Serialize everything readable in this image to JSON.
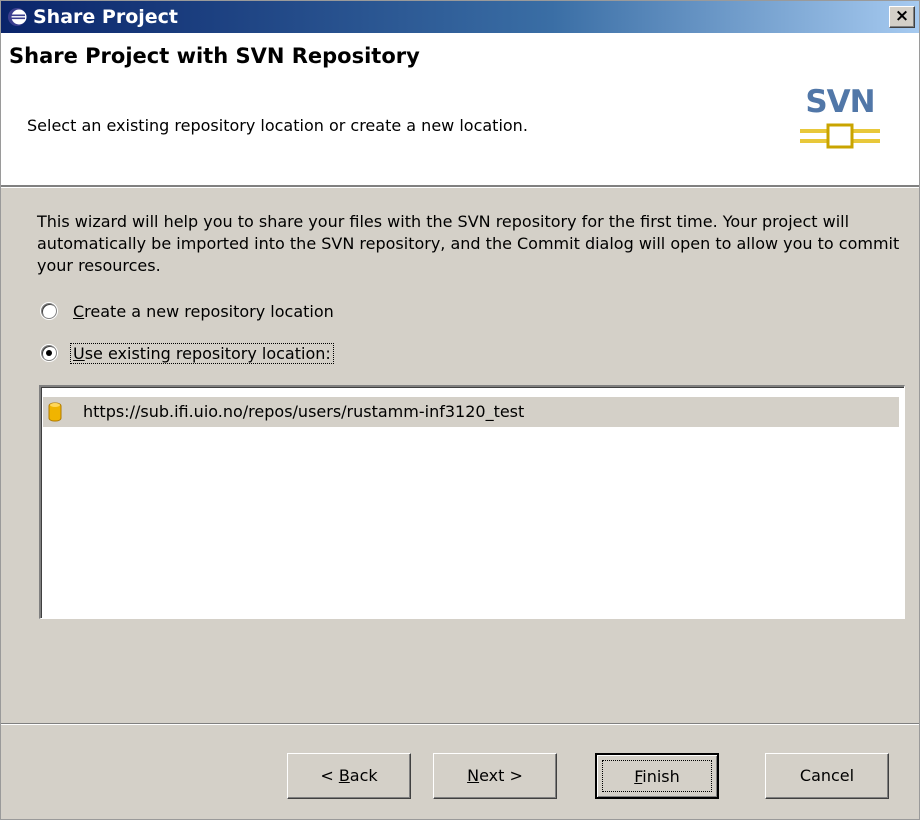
{
  "window": {
    "title": "Share Project",
    "close_label": "×",
    "title_icon": "eclipse-icon"
  },
  "banner": {
    "title": "Share Project with SVN Repository",
    "description": "Select an existing repository location or create a new location.",
    "logo_text": "SVN"
  },
  "intro_text": "This wizard will help you to share your files with the SVN repository for the first time. Your project will automatically be imported into the SVN repository, and the Commit dialog will open to allow you to commit your resources.",
  "options": [
    {
      "label_accel": "C",
      "label_rest": "reate a new repository location",
      "checked": false
    },
    {
      "label_accel": "U",
      "label_rest": "se existing repository location:",
      "checked": true
    }
  ],
  "repositories": [
    {
      "url": "https://sub.ifi.uio.no/repos/users/rustamm-inf3120_test",
      "icon": "repository-icon",
      "selected": true
    }
  ],
  "buttons": {
    "back_prefix": "< ",
    "back_accel": "B",
    "back_rest": "ack",
    "next_accel": "N",
    "next_rest": "ext >",
    "finish_accel": "F",
    "finish_rest": "inish",
    "cancel": "Cancel"
  },
  "colors": {
    "dialog_bg": "#d4d0c8",
    "titlebar_start": "#0a246a",
    "titlebar_end": "#a6caf0",
    "svn_blue": "#5177a8",
    "repo_icon": "#f0b400"
  }
}
